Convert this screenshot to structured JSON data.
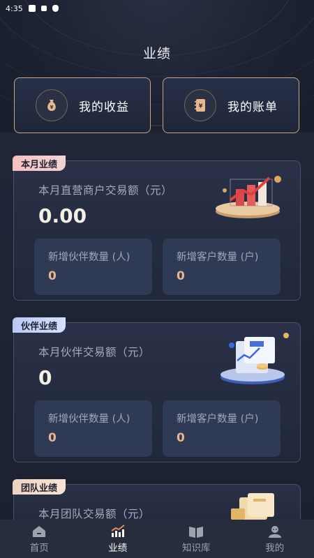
{
  "status_bar": {
    "time": "4:35"
  },
  "header": {
    "title": "业绩"
  },
  "quick_actions": [
    {
      "label": "我的收益",
      "icon": "money-bag-icon"
    },
    {
      "label": "我的账单",
      "icon": "bill-icon"
    }
  ],
  "cards": [
    {
      "tag": "本月业绩",
      "subtitle": "本月直营商户交易额（元）",
      "value": "0.00",
      "stats": [
        {
          "label": "新增伙伴数量 (人)",
          "value": "0"
        },
        {
          "label": "新增客户数量 (户)",
          "value": "0"
        }
      ]
    },
    {
      "tag": "伙伴业绩",
      "subtitle": "本月伙伴交易额（元）",
      "value": "0",
      "stats": [
        {
          "label": "新增伙伴数量 (人)",
          "value": "0"
        },
        {
          "label": "新增客户数量 (户)",
          "value": "0"
        }
      ]
    },
    {
      "tag": "团队业绩",
      "subtitle": "本月团队交易额（元）"
    }
  ],
  "tabbar": [
    {
      "label": "首页",
      "icon": "home-icon",
      "active": false
    },
    {
      "label": "业绩",
      "icon": "performance-chart-icon",
      "active": true
    },
    {
      "label": "知识库",
      "icon": "book-icon",
      "active": false
    },
    {
      "label": "我的",
      "icon": "profile-icon",
      "active": false
    }
  ],
  "colors": {
    "accent_gold": "#c6a685",
    "value_orange": "#e9b48e",
    "background": "#1b2130"
  }
}
